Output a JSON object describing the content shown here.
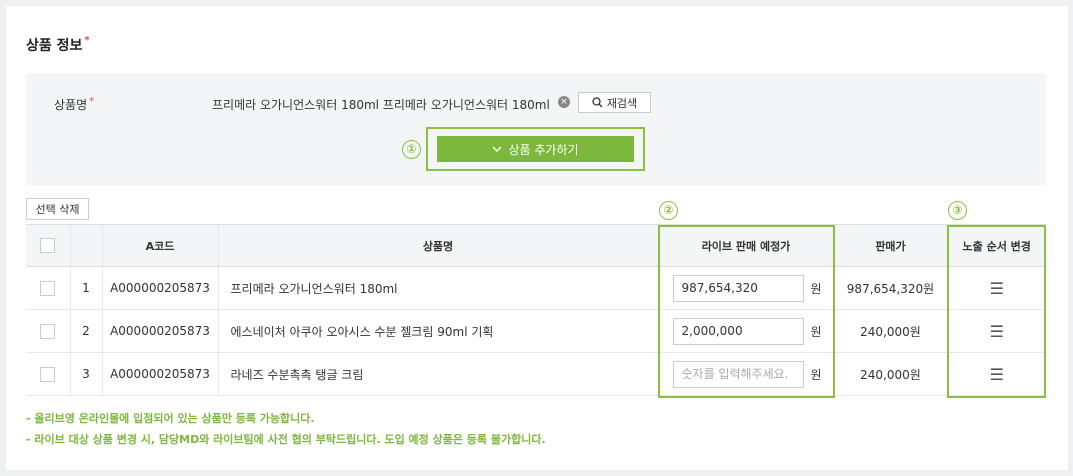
{
  "section": {
    "title": "상품 정보",
    "required_mark": "*"
  },
  "search": {
    "label": "상품명",
    "required_mark": "*",
    "value": "프리메라 오가니언스워터 180ml 프리메라 오가니언스워터 180ml",
    "research_label": "재검색",
    "add_label": "상품 추가하기"
  },
  "markers": {
    "one": "①",
    "two": "②",
    "three": "③"
  },
  "toolbar": {
    "delete_label": "선택 삭제"
  },
  "table": {
    "headers": {
      "code": "A코드",
      "name": "상품명",
      "live_price": "라이브 판매 예정가",
      "price": "판매가",
      "order": "노출 순서 변경"
    },
    "currency": "원",
    "placeholder": "숫자를 입력해주세요.",
    "rows": [
      {
        "num": "1",
        "code": "A000000205873",
        "name": "프리메라 오가니언스워터 180ml",
        "live_price": "987,654,320",
        "price": "987,654,320원"
      },
      {
        "num": "2",
        "code": "A000000205873",
        "name": "에스네이처 아쿠아 오아시스 수분 젤크림 90ml 기획",
        "live_price": "2,000,000",
        "price": "240,000원"
      },
      {
        "num": "3",
        "code": "A000000205873",
        "name": "라네즈 수분촉촉 탱글 크림",
        "live_price": "",
        "price": "240,000원"
      }
    ]
  },
  "notes": [
    "- 올리브영 온라인몰에 입점되어 있는 상품만 등록 가능합니다.",
    "- 라이브 대상 상품 변경 시, 담당MD와 라이브팀에 사전 협의 부탁드립니다. 도입 예정 상품은 등록 불가합니다."
  ],
  "colors": {
    "accent": "#7cb83e",
    "highlight": "#8cbf3f",
    "required": "#e74c3c"
  },
  "icons": {
    "clear": "clear-circle-icon",
    "search": "search-icon",
    "chevron": "chevron-down-icon",
    "drag": "drag-handle-icon"
  }
}
